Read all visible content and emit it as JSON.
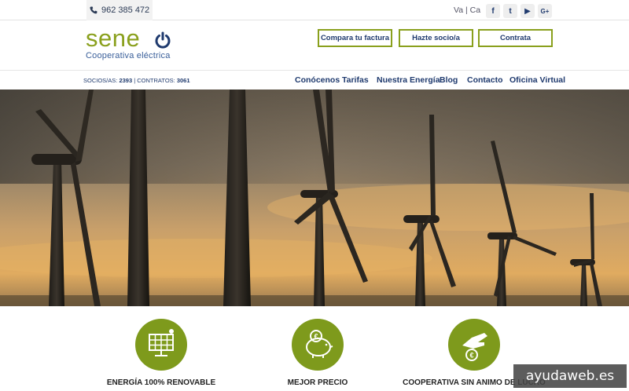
{
  "topbar": {
    "phone": "962 385 472",
    "languages": "Va | Ca",
    "social": [
      {
        "name": "facebook-icon",
        "glyph": "f"
      },
      {
        "name": "twitter-icon",
        "glyph": "t"
      },
      {
        "name": "youtube-icon",
        "glyph": "▶"
      },
      {
        "name": "googleplus-icon",
        "glyph": "G+"
      }
    ]
  },
  "brand": {
    "name": "sene",
    "tagline": "Cooperativa eléctrica",
    "color_green": "#8aa01d",
    "color_navy": "#1f3a6e"
  },
  "header": {
    "cta": [
      "Compara tu factura",
      "Hazte socio/a",
      "Contrata"
    ]
  },
  "stats": {
    "members_label": "SOCIOS/AS:",
    "members_value": "2393",
    "contracts_label": "| CONTRATOS:",
    "contracts_value": "3061"
  },
  "nav": {
    "items": [
      "Conócenos",
      "Tarifas",
      "Nuestra Energía",
      "Blog",
      "Contacto",
      "Oficina Virtual"
    ]
  },
  "features": [
    {
      "label": "ENERGÍA 100% RENOVABLE",
      "icon": "solar-panel-icon"
    },
    {
      "label": "MEJOR PRECIO",
      "icon": "piggy-bank-icon"
    },
    {
      "label": "COOPERATIVA SIN ANIMO DE LUCRO",
      "icon": "hand-coin-icon"
    }
  ],
  "watermark": "ayudaweb.es"
}
